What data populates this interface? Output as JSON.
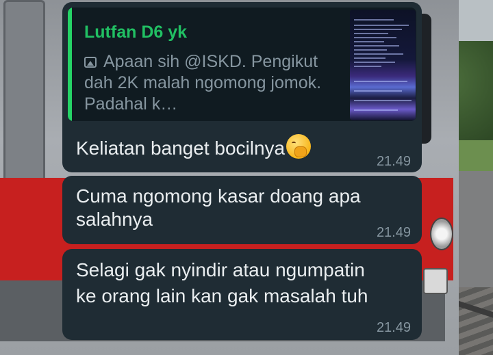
{
  "messages": [
    {
      "reply_to": {
        "author": "Lutfan D6 yk",
        "media_icon": "image-icon",
        "preview_text": "Apaan sih @ISKD. Pengikut dah 2K malah ngomong jomok. Padahal k…"
      },
      "text": "Keliatan banget bocilnya",
      "emoji": "face-with-hand-over-mouth",
      "time": "21.49"
    },
    {
      "text_lines": [
        "Cuma ngomong kasar doang apa",
        "salahnya"
      ],
      "time": "21.49"
    },
    {
      "text_lines": [
        "Selagi gak nyindir atau ngumpatin",
        "ke orang lain kan gak masalah tuh"
      ],
      "time": "21.49"
    }
  ],
  "colors": {
    "bubble": "#1f2c34",
    "quote_bg": "#101b21",
    "accent_green": "#21c063",
    "text": "#e9edef",
    "meta": "#8696a0"
  }
}
